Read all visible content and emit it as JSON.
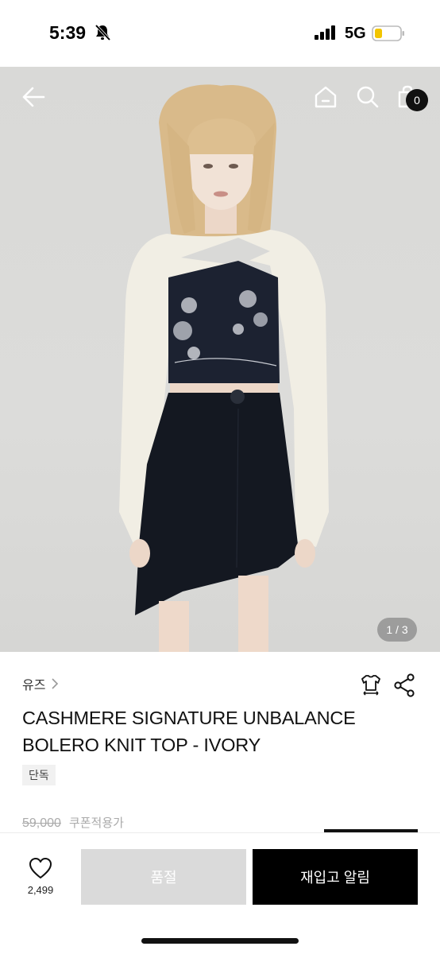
{
  "status_bar": {
    "time": "5:39",
    "network": "5G"
  },
  "header": {
    "cart_count": "0"
  },
  "gallery": {
    "page_indicator": "1 / 3"
  },
  "product": {
    "brand": "유즈",
    "title": "CASHMERE SIGNATURE UNBALANCE BOLERO KNIT TOP - IVORY",
    "tag": "단독",
    "original_price": "59,000",
    "coupon_label": "쿠폰적용가"
  },
  "bottom_bar": {
    "like_count": "2,499",
    "soldout_label": "품절",
    "restock_label": "재입고 알림"
  },
  "colors": {
    "primary": "#000000",
    "disabled": "#dadada",
    "badge": "#111111"
  },
  "icons": [
    "bell-slash-icon",
    "signal-icon",
    "battery-icon",
    "back-arrow-icon",
    "home-icon",
    "search-icon",
    "shopping-bag-icon",
    "chevron-right-icon",
    "size-guide-icon",
    "share-icon",
    "heart-icon"
  ]
}
